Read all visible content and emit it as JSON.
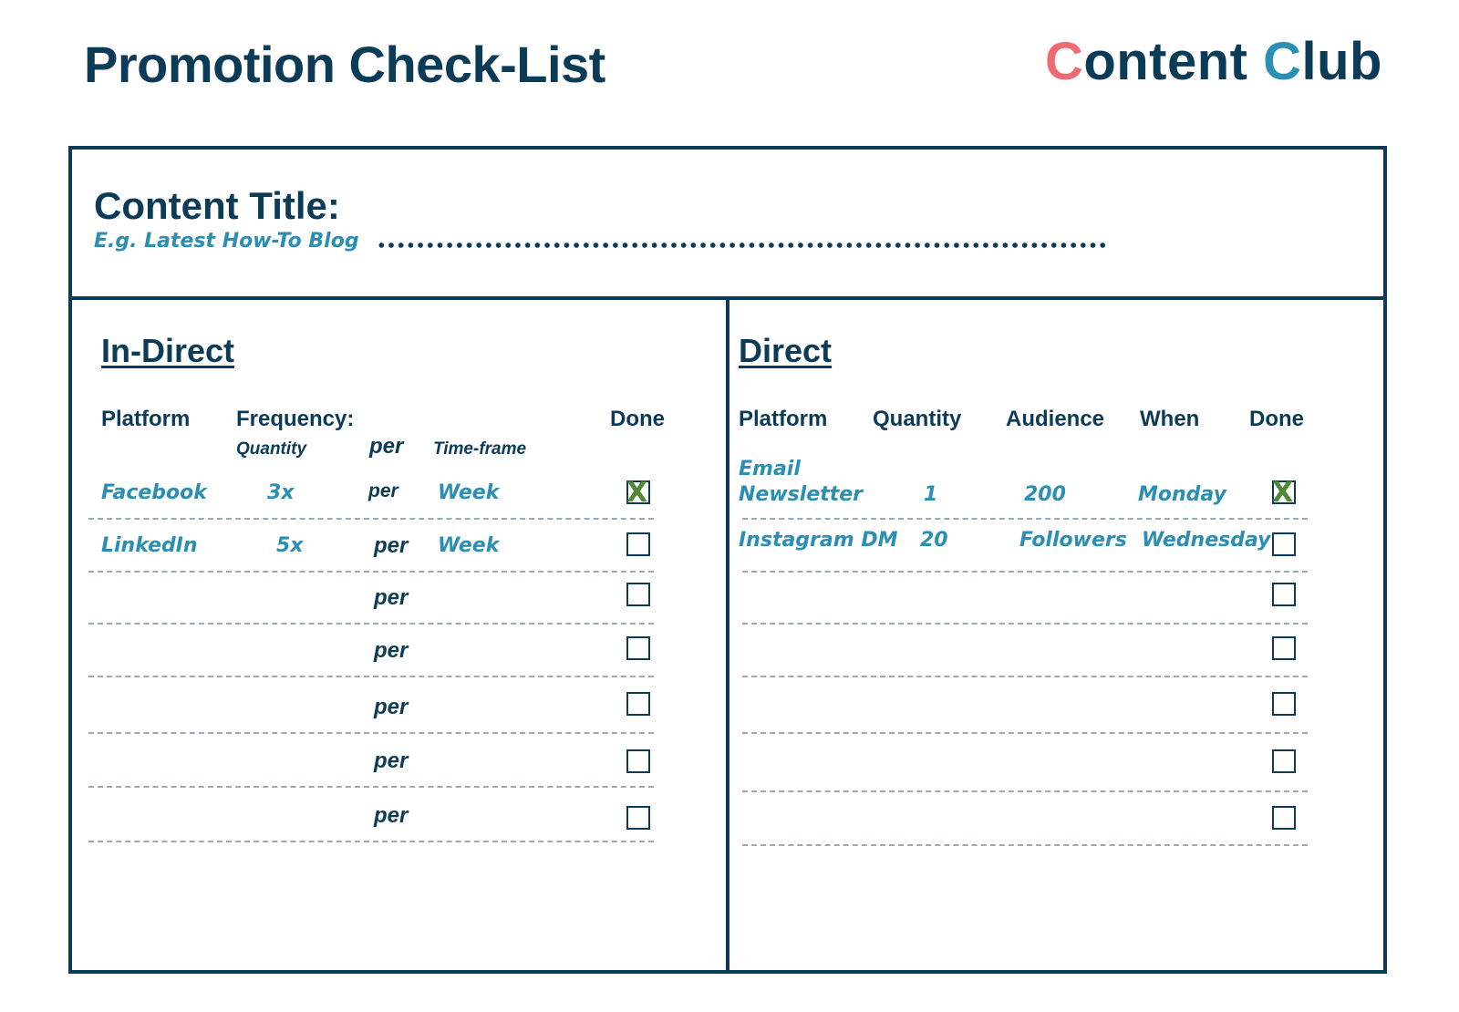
{
  "page": {
    "title": "Promotion Check-List"
  },
  "logo": {
    "c1": "C",
    "part1": "ontent ",
    "c2": "C",
    "part2": "lub"
  },
  "content_title": {
    "label": "Content Title:",
    "hint": "E.g. Latest How-To Blog",
    "value": ""
  },
  "indirect": {
    "heading": "In-Direct",
    "headers": {
      "platform": "Platform",
      "frequency": "Frequency:",
      "done": "Done",
      "quantity": "Quantity",
      "per": "per",
      "timeframe": "Time-frame"
    },
    "rows": [
      {
        "platform": "Facebook",
        "quantity": "3x",
        "per": "per",
        "timeframe": "Week",
        "done": true
      },
      {
        "platform": "LinkedIn",
        "quantity": "5x",
        "per": "per",
        "timeframe": "Week",
        "done": false
      },
      {
        "platform": "",
        "quantity": "",
        "per": "per",
        "timeframe": "",
        "done": false
      },
      {
        "platform": "",
        "quantity": "",
        "per": "per",
        "timeframe": "",
        "done": false
      },
      {
        "platform": "",
        "quantity": "",
        "per": "per",
        "timeframe": "",
        "done": false
      },
      {
        "platform": "",
        "quantity": "",
        "per": "per",
        "timeframe": "",
        "done": false
      },
      {
        "platform": "",
        "quantity": "",
        "per": "per",
        "timeframe": "",
        "done": false
      }
    ]
  },
  "direct": {
    "heading": "Direct",
    "headers": {
      "platform": "Platform",
      "quantity": "Quantity",
      "audience": "Audience",
      "when": "When",
      "done": "Done"
    },
    "rows": [
      {
        "platform_line1": "Email",
        "platform_line2": "Newsletter",
        "quantity": "1",
        "audience": "200",
        "when": "Monday",
        "done": true
      },
      {
        "platform_line1": "Instagram DM",
        "platform_line2": "",
        "quantity": "20",
        "audience": "Followers",
        "when": "Wednesday",
        "done": false
      },
      {
        "platform_line1": "",
        "platform_line2": "",
        "quantity": "",
        "audience": "",
        "when": "",
        "done": false
      },
      {
        "platform_line1": "",
        "platform_line2": "",
        "quantity": "",
        "audience": "",
        "when": "",
        "done": false
      },
      {
        "platform_line1": "",
        "platform_line2": "",
        "quantity": "",
        "audience": "",
        "when": "",
        "done": false
      },
      {
        "platform_line1": "",
        "platform_line2": "",
        "quantity": "",
        "audience": "",
        "when": "",
        "done": false
      },
      {
        "platform_line1": "",
        "platform_line2": "",
        "quantity": "",
        "audience": "",
        "when": "",
        "done": false
      }
    ]
  },
  "check_symbol": "X",
  "colors": {
    "navy": "#0c3b57",
    "teal": "#2a8fb3",
    "coral": "#ee6b73",
    "check_green": "#4e8a35"
  }
}
